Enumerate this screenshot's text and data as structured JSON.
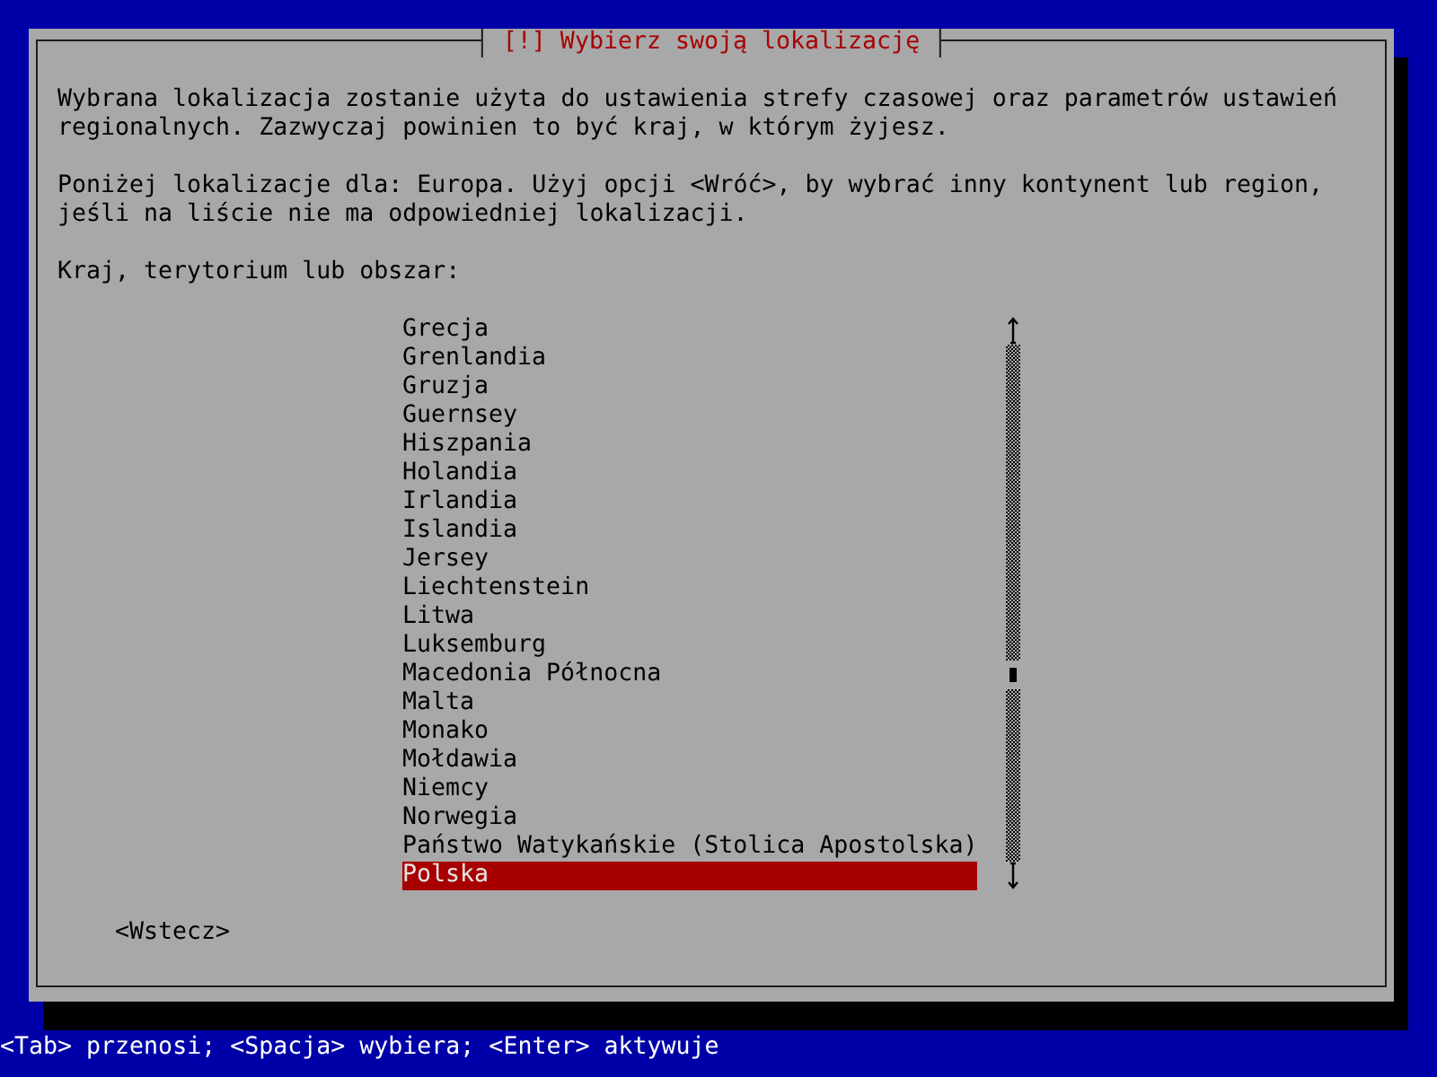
{
  "window": {
    "title": "[!] Wybierz swoją lokalizację"
  },
  "description": [
    "Wybrana lokalizacja zostanie użyta do ustawienia strefy czasowej oraz parametrów ustawień regionalnych. Zazwyczaj powinien to być kraj, w którym żyjesz.",
    "Poniżej lokalizacje dla: Europa. Użyj opcji <Wróć>, by wybrać inny kontynent lub region, jeśli na liście nie ma odpowiedniej lokalizacji."
  ],
  "list": {
    "label": "Kraj, terytorium lub obszar:",
    "items": [
      {
        "label": "Grecja",
        "selected": false
      },
      {
        "label": "Grenlandia",
        "selected": false
      },
      {
        "label": "Gruzja",
        "selected": false
      },
      {
        "label": "Guernsey",
        "selected": false
      },
      {
        "label": "Hiszpania",
        "selected": false
      },
      {
        "label": "Holandia",
        "selected": false
      },
      {
        "label": "Irlandia",
        "selected": false
      },
      {
        "label": "Islandia",
        "selected": false
      },
      {
        "label": "Jersey",
        "selected": false
      },
      {
        "label": "Liechtenstein",
        "selected": false
      },
      {
        "label": "Litwa",
        "selected": false
      },
      {
        "label": "Luksemburg",
        "selected": false
      },
      {
        "label": "Macedonia Północna",
        "selected": false
      },
      {
        "label": "Malta",
        "selected": false
      },
      {
        "label": "Monako",
        "selected": false
      },
      {
        "label": "Mołdawia",
        "selected": false
      },
      {
        "label": "Niemcy",
        "selected": false
      },
      {
        "label": "Norwegia",
        "selected": false
      },
      {
        "label": "Państwo Watykańskie (Stolica Apostolska)",
        "selected": false
      },
      {
        "label": "Polska",
        "selected": true
      }
    ]
  },
  "back_button": "<Wstecz>",
  "status_bar": "<Tab> przenosi; <Spacja> wybiera; <Enter> aktywuje"
}
